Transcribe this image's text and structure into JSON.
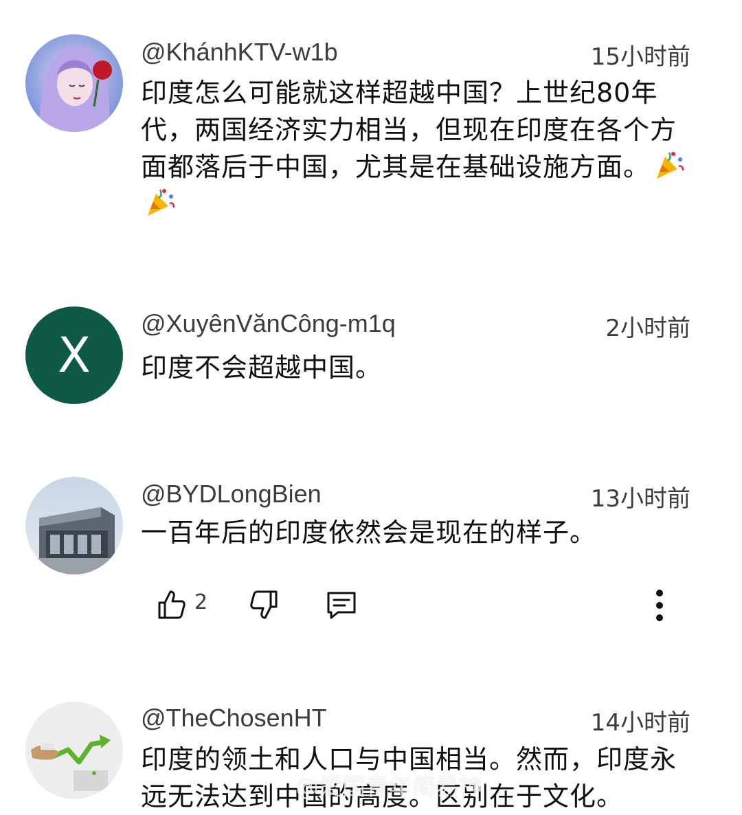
{
  "comments": [
    {
      "handle": "@KhánhKTV-w1b",
      "time": "15小时前",
      "text": "印度怎么可能就这样超越中国？上世纪80年代，两国经济实力相当，但现在印度在各个方面都落后于中国，尤其是在基础设施方面。",
      "emoji": "party-popper-icon"
    },
    {
      "handle": "@XuyênVănCông-m1q",
      "time": "2小时前",
      "text": "印度不会超越中国。",
      "avatar_letter": "X",
      "avatar_color": "#0f5a47"
    },
    {
      "handle": "@BYDLongBien",
      "time": "13小时前",
      "text": "一百年后的印度依然会是现在的样子。",
      "likes": "2"
    },
    {
      "handle": "@TheChosenHT",
      "time": "14小时前",
      "text": "印度的领土和人口与中国相当。然而，印度永远无法达到中国的高度。区别在于文化。"
    }
  ],
  "actions": {
    "like_icon": "thumbs-up-icon",
    "dislike_icon": "thumbs-down-icon",
    "reply_icon": "reply-comment-icon",
    "more_icon": "more-vertical-icon"
  },
  "watermark": "@爱国青年简易神",
  "colors": {
    "text": "#0f0f0f",
    "meta": "#3c3c3c",
    "letter_avatar": "#0f5a47"
  }
}
